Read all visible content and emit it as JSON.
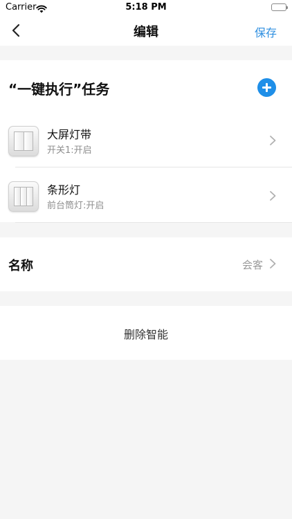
{
  "status_bar": {
    "carrier": "Carrier",
    "time": "5:18 PM",
    "battery_level": 1.0
  },
  "nav": {
    "title": "编辑",
    "save_label": "保存",
    "back_icon": "chevron-left-icon"
  },
  "tasks_section": {
    "title": "“一键执行”任务",
    "add_icon": "plus-circle-icon",
    "items": [
      {
        "name": "大屏灯带",
        "detail": "开关1:开启",
        "icon": "wall-switch-icon"
      },
      {
        "name": "条形灯",
        "detail": "前台筒灯:开启",
        "icon": "wall-switch-icon"
      }
    ]
  },
  "name_row": {
    "label": "名称",
    "value": "会客"
  },
  "delete_row": {
    "label": "删除智能"
  },
  "colors": {
    "accent": "#2f8fe0",
    "add_button": "#1f8fe8",
    "background": "#f5f5f5",
    "secondary_text": "#8e8e8e"
  }
}
